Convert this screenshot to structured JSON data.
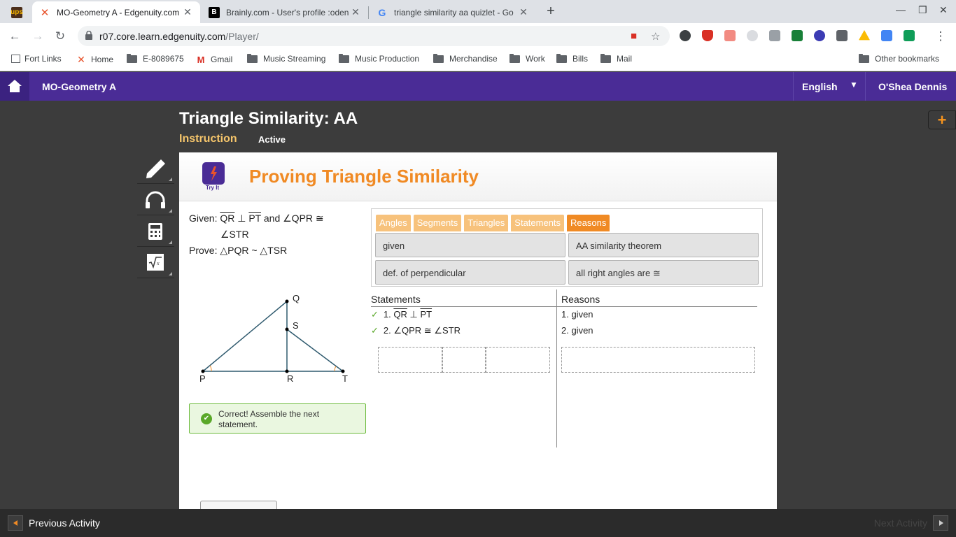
{
  "browser": {
    "tabs": [
      {
        "title": "",
        "favicon": "ups-icon"
      },
      {
        "title": "MO-Geometry A - Edgenuity.com",
        "favicon": "edgenuity-icon"
      },
      {
        "title": "Brainly.com - User's profile :oden",
        "favicon": "brainly-icon"
      },
      {
        "title": "triangle similarity aa quizlet - Go",
        "favicon": "google-icon"
      }
    ],
    "url_host": "r07.core.learn.edgenuity.com",
    "url_path": "/Player/",
    "bookmarks": [
      "Fort Links",
      "Home",
      "E-8089675",
      "Gmail",
      "Music Streaming",
      "Music Production",
      "Merchandise",
      "Work",
      "Bills",
      "Mail"
    ],
    "other_bookmarks": "Other bookmarks"
  },
  "app": {
    "course": "MO-Geometry A",
    "language": "English",
    "user": "O'Shea Dennis"
  },
  "lesson": {
    "title": "Triangle Similarity: AA",
    "section": "Instruction",
    "status": "Active"
  },
  "activity": {
    "try_it_label": "Try It",
    "title": "Proving Triangle Similarity",
    "given_prefix": "Given: ",
    "given_seg1": "QR",
    "given_perp": " ⊥ ",
    "given_seg2": "PT",
    "given_rest": " and ∠QPR ≅",
    "given_line2": "∠STR",
    "prove": "Prove: △PQR ~ △TSR",
    "bank_tabs": [
      "Angles",
      "Segments",
      "Triangles",
      "Statements",
      "Reasons"
    ],
    "selected_tab": "Reasons",
    "tiles": [
      "given",
      "AA similarity theorem",
      "def. of perpendicular",
      "all right angles are ≅"
    ],
    "diagram_labels": {
      "Q": "Q",
      "S": "S",
      "P": "P",
      "R": "R",
      "T": "T"
    },
    "feedback": "Correct! Assemble the next statement.",
    "proof": {
      "statements_header": "Statements",
      "reasons_header": "Reasons",
      "rows": [
        {
          "check": "✓",
          "num": "1. ",
          "seg1": "QR",
          "perp": " ⊥ ",
          "seg2": "PT",
          "reason": "1. given"
        },
        {
          "check": "✓",
          "text": "2. ∠QPR ≅ ∠STR",
          "reason": "2. given"
        }
      ]
    }
  },
  "footer": {
    "previous": "Previous Activity",
    "next": "Next Activity"
  },
  "colors": {
    "header_purple": "#4a2c96",
    "accent_orange": "#f08a24",
    "success_green": "#5aa829"
  }
}
